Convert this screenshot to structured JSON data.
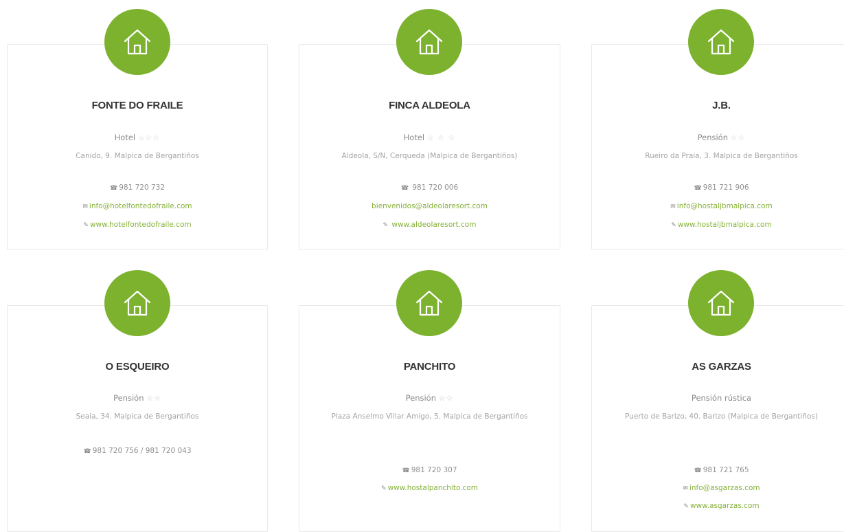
{
  "colors": {
    "accent": "#7cb22e",
    "link": "#86b23a",
    "text_muted": "#a3a3a3"
  },
  "listings": [
    {
      "name": "FONTE DO FRAILE",
      "category": "Hotel",
      "stars": "☆☆☆",
      "address": "Canido, 9. Malpica de Bergantiños",
      "phone": "981 720 732",
      "email": "info@hotelfontedofraile.com",
      "web": "www.hotelfontedofraile.com"
    },
    {
      "name": "FINCA ALDEOLA",
      "category": "Hotel",
      "stars": "☆ ☆ ☆",
      "address": "Aldeola, S/N, Cerqueda (Malpica de Bergantiños)",
      "phone": " 981 720 006",
      "email": "bienvenidos@aldeolaresort.com",
      "web": " www.aldeolaresort.com"
    },
    {
      "name": "J.B.",
      "category": "Pensión",
      "stars": "☆☆",
      "address": "Rueiro da Praia, 3. Malpica de Bergantiños",
      "phone": "981 721 906",
      "email": "info@hostaljbmalpica.com",
      "web": "www.hostaljbmalpica.com"
    },
    {
      "name": "O ESQUEIRO",
      "category": "Pensión",
      "stars": "☆☆",
      "address": "Seaia, 34. Malpica de Bergantiños",
      "phone": "981 720 756 / 981 720 043"
    },
    {
      "name": "PANCHITO",
      "category": "Pensión",
      "stars": "☆☆",
      "address": "Plaza Anselmo Villar Amigo, 5. Malpica de Bergantiños",
      "phone": "981 720 307",
      "web": "www.hostalpanchito.com"
    },
    {
      "name": "AS GARZAS",
      "category": "Pensión rústica",
      "stars": "",
      "address": "Puerto de Barizo, 40. Barizo (Malpica de Bergantiños)",
      "phone": "981 721 765",
      "email": "info@asgarzas.com",
      "web": "www.asgarzas.com"
    }
  ]
}
